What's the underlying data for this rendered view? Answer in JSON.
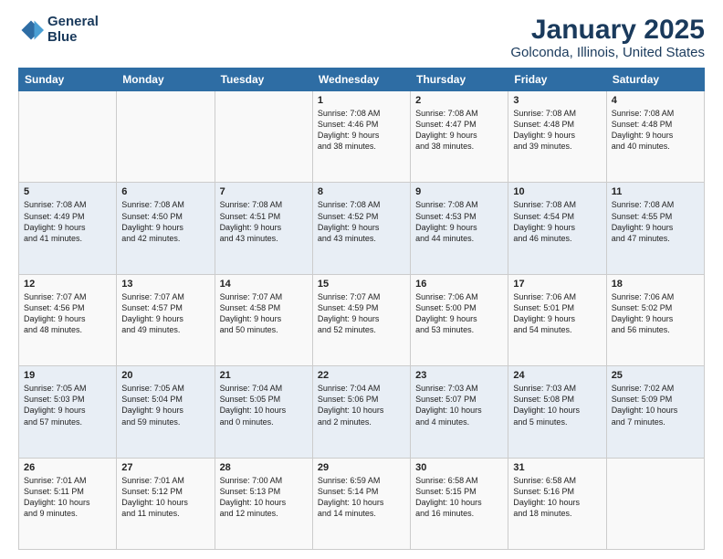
{
  "logo": {
    "line1": "General",
    "line2": "Blue"
  },
  "title": "January 2025",
  "subtitle": "Golconda, Illinois, United States",
  "weekdays": [
    "Sunday",
    "Monday",
    "Tuesday",
    "Wednesday",
    "Thursday",
    "Friday",
    "Saturday"
  ],
  "weeks": [
    [
      {
        "day": "",
        "info": ""
      },
      {
        "day": "",
        "info": ""
      },
      {
        "day": "",
        "info": ""
      },
      {
        "day": "1",
        "info": "Sunrise: 7:08 AM\nSunset: 4:46 PM\nDaylight: 9 hours\nand 38 minutes."
      },
      {
        "day": "2",
        "info": "Sunrise: 7:08 AM\nSunset: 4:47 PM\nDaylight: 9 hours\nand 38 minutes."
      },
      {
        "day": "3",
        "info": "Sunrise: 7:08 AM\nSunset: 4:48 PM\nDaylight: 9 hours\nand 39 minutes."
      },
      {
        "day": "4",
        "info": "Sunrise: 7:08 AM\nSunset: 4:48 PM\nDaylight: 9 hours\nand 40 minutes."
      }
    ],
    [
      {
        "day": "5",
        "info": "Sunrise: 7:08 AM\nSunset: 4:49 PM\nDaylight: 9 hours\nand 41 minutes."
      },
      {
        "day": "6",
        "info": "Sunrise: 7:08 AM\nSunset: 4:50 PM\nDaylight: 9 hours\nand 42 minutes."
      },
      {
        "day": "7",
        "info": "Sunrise: 7:08 AM\nSunset: 4:51 PM\nDaylight: 9 hours\nand 43 minutes."
      },
      {
        "day": "8",
        "info": "Sunrise: 7:08 AM\nSunset: 4:52 PM\nDaylight: 9 hours\nand 43 minutes."
      },
      {
        "day": "9",
        "info": "Sunrise: 7:08 AM\nSunset: 4:53 PM\nDaylight: 9 hours\nand 44 minutes."
      },
      {
        "day": "10",
        "info": "Sunrise: 7:08 AM\nSunset: 4:54 PM\nDaylight: 9 hours\nand 46 minutes."
      },
      {
        "day": "11",
        "info": "Sunrise: 7:08 AM\nSunset: 4:55 PM\nDaylight: 9 hours\nand 47 minutes."
      }
    ],
    [
      {
        "day": "12",
        "info": "Sunrise: 7:07 AM\nSunset: 4:56 PM\nDaylight: 9 hours\nand 48 minutes."
      },
      {
        "day": "13",
        "info": "Sunrise: 7:07 AM\nSunset: 4:57 PM\nDaylight: 9 hours\nand 49 minutes."
      },
      {
        "day": "14",
        "info": "Sunrise: 7:07 AM\nSunset: 4:58 PM\nDaylight: 9 hours\nand 50 minutes."
      },
      {
        "day": "15",
        "info": "Sunrise: 7:07 AM\nSunset: 4:59 PM\nDaylight: 9 hours\nand 52 minutes."
      },
      {
        "day": "16",
        "info": "Sunrise: 7:06 AM\nSunset: 5:00 PM\nDaylight: 9 hours\nand 53 minutes."
      },
      {
        "day": "17",
        "info": "Sunrise: 7:06 AM\nSunset: 5:01 PM\nDaylight: 9 hours\nand 54 minutes."
      },
      {
        "day": "18",
        "info": "Sunrise: 7:06 AM\nSunset: 5:02 PM\nDaylight: 9 hours\nand 56 minutes."
      }
    ],
    [
      {
        "day": "19",
        "info": "Sunrise: 7:05 AM\nSunset: 5:03 PM\nDaylight: 9 hours\nand 57 minutes."
      },
      {
        "day": "20",
        "info": "Sunrise: 7:05 AM\nSunset: 5:04 PM\nDaylight: 9 hours\nand 59 minutes."
      },
      {
        "day": "21",
        "info": "Sunrise: 7:04 AM\nSunset: 5:05 PM\nDaylight: 10 hours\nand 0 minutes."
      },
      {
        "day": "22",
        "info": "Sunrise: 7:04 AM\nSunset: 5:06 PM\nDaylight: 10 hours\nand 2 minutes."
      },
      {
        "day": "23",
        "info": "Sunrise: 7:03 AM\nSunset: 5:07 PM\nDaylight: 10 hours\nand 4 minutes."
      },
      {
        "day": "24",
        "info": "Sunrise: 7:03 AM\nSunset: 5:08 PM\nDaylight: 10 hours\nand 5 minutes."
      },
      {
        "day": "25",
        "info": "Sunrise: 7:02 AM\nSunset: 5:09 PM\nDaylight: 10 hours\nand 7 minutes."
      }
    ],
    [
      {
        "day": "26",
        "info": "Sunrise: 7:01 AM\nSunset: 5:11 PM\nDaylight: 10 hours\nand 9 minutes."
      },
      {
        "day": "27",
        "info": "Sunrise: 7:01 AM\nSunset: 5:12 PM\nDaylight: 10 hours\nand 11 minutes."
      },
      {
        "day": "28",
        "info": "Sunrise: 7:00 AM\nSunset: 5:13 PM\nDaylight: 10 hours\nand 12 minutes."
      },
      {
        "day": "29",
        "info": "Sunrise: 6:59 AM\nSunset: 5:14 PM\nDaylight: 10 hours\nand 14 minutes."
      },
      {
        "day": "30",
        "info": "Sunrise: 6:58 AM\nSunset: 5:15 PM\nDaylight: 10 hours\nand 16 minutes."
      },
      {
        "day": "31",
        "info": "Sunrise: 6:58 AM\nSunset: 5:16 PM\nDaylight: 10 hours\nand 18 minutes."
      },
      {
        "day": "",
        "info": ""
      }
    ]
  ]
}
